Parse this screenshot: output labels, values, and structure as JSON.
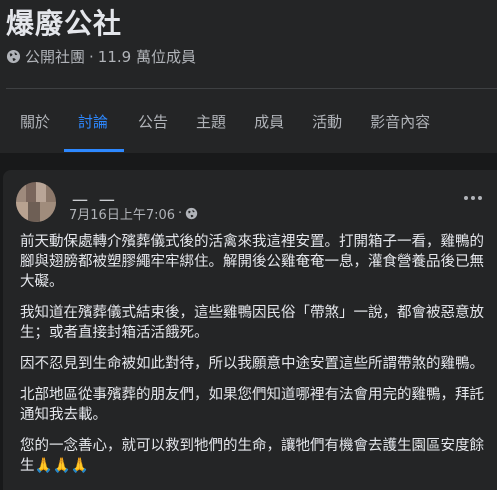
{
  "group": {
    "name": "爆廢公社",
    "privacy": "公開社團",
    "separator": "·",
    "members": "11.9 萬位成員"
  },
  "tabs": [
    {
      "label": "關於",
      "active": false
    },
    {
      "label": "討論",
      "active": true
    },
    {
      "label": "公告",
      "active": false
    },
    {
      "label": "主題",
      "active": false
    },
    {
      "label": "成員",
      "active": false
    },
    {
      "label": "活動",
      "active": false
    },
    {
      "label": "影音內容",
      "active": false
    }
  ],
  "post": {
    "author": "＿ ＿",
    "timestamp": "7月16日上午7:06",
    "separator": "·",
    "paragraphs": [
      "前天動保處轉介殯葬儀式後的活禽來我這裡安置。打開箱子一看，雞鴨的腳與翅膀都被塑膠繩牢牢綁住。解開後公雞奄奄一息，灌食營養品後已無大礙。",
      "我知道在殯葬儀式結束後，這些雞鴨因民俗「帶煞」一說，都會被惡意放生；或者直接封箱活活餓死。",
      "因不忍見到生命被如此對待，所以我願意中途安置這些所謂帶煞的雞鴨。",
      "北部地區從事殯葬的朋友們，如果您們知道哪裡有法會用完的雞鴨，拜託通知我去載。",
      "您的一念善心，就可以救到牠們的生命，讓牠們有機會去護生園區安度餘生🙏🙏🙏"
    ]
  },
  "colors": {
    "background": "#18191a",
    "surface": "#242526",
    "text_primary": "#e4e6eb",
    "text_secondary": "#b0b3b8",
    "accent": "#2d88ff"
  },
  "icons": {
    "privacy": "globe-icon",
    "audience": "globe-icon",
    "more": "more-horizontal-icon"
  }
}
